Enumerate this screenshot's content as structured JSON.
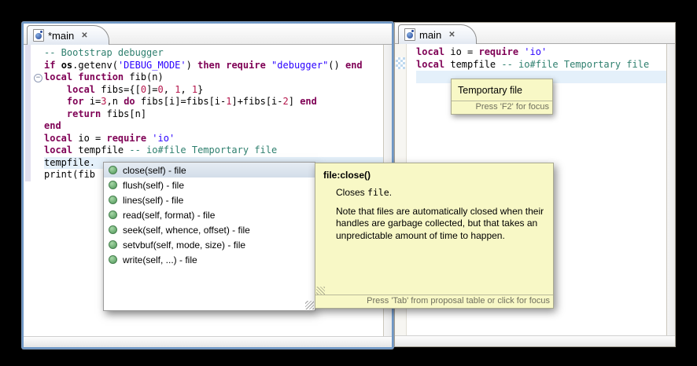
{
  "left_editor": {
    "tab": {
      "label": "*main",
      "icon": "lua-file-icon"
    },
    "lines": [
      [
        {
          "t": "-- Bootstrap debugger",
          "c": "c"
        }
      ],
      [
        {
          "t": "if",
          "c": "k"
        },
        {
          "t": " ",
          "c": "p"
        },
        {
          "t": "os",
          "c": "b"
        },
        {
          "t": ".getenv(",
          "c": "p"
        },
        {
          "t": "'DEBUG_MODE'",
          "c": "s"
        },
        {
          "t": ") ",
          "c": "p"
        },
        {
          "t": "then",
          "c": "k"
        },
        {
          "t": " ",
          "c": "p"
        },
        {
          "t": "require",
          "c": "k"
        },
        {
          "t": " ",
          "c": "p"
        },
        {
          "t": "\"debugger\"",
          "c": "s"
        },
        {
          "t": "() ",
          "c": "p"
        },
        {
          "t": "end",
          "c": "k"
        }
      ],
      [
        {
          "t": "local",
          "c": "k"
        },
        {
          "t": " ",
          "c": "p"
        },
        {
          "t": "function",
          "c": "k"
        },
        {
          "t": " fib(n)",
          "c": "p"
        }
      ],
      [
        {
          "t": "    ",
          "c": "p"
        },
        {
          "t": "local",
          "c": "k"
        },
        {
          "t": " fibs={[",
          "c": "p"
        },
        {
          "t": "0",
          "c": "n"
        },
        {
          "t": "]=",
          "c": "p"
        },
        {
          "t": "0",
          "c": "n"
        },
        {
          "t": ", ",
          "c": "p"
        },
        {
          "t": "1",
          "c": "n"
        },
        {
          "t": ", ",
          "c": "p"
        },
        {
          "t": "1",
          "c": "n"
        },
        {
          "t": "}",
          "c": "p"
        }
      ],
      [
        {
          "t": "    ",
          "c": "p"
        },
        {
          "t": "for",
          "c": "k"
        },
        {
          "t": " i=",
          "c": "p"
        },
        {
          "t": "3",
          "c": "n"
        },
        {
          "t": ",n ",
          "c": "p"
        },
        {
          "t": "do",
          "c": "k"
        },
        {
          "t": " fibs[i]=fibs[i-",
          "c": "p"
        },
        {
          "t": "1",
          "c": "n"
        },
        {
          "t": "]+fibs[i-",
          "c": "p"
        },
        {
          "t": "2",
          "c": "n"
        },
        {
          "t": "] ",
          "c": "p"
        },
        {
          "t": "end",
          "c": "k"
        }
      ],
      [
        {
          "t": "    ",
          "c": "p"
        },
        {
          "t": "return",
          "c": "k"
        },
        {
          "t": " fibs[n]",
          "c": "p"
        }
      ],
      [
        {
          "t": "end",
          "c": "k"
        }
      ],
      [
        {
          "t": "local",
          "c": "k"
        },
        {
          "t": " io = ",
          "c": "p"
        },
        {
          "t": "require",
          "c": "k"
        },
        {
          "t": " ",
          "c": "p"
        },
        {
          "t": "'io'",
          "c": "s"
        }
      ],
      [
        {
          "t": "local",
          "c": "k"
        },
        {
          "t": " tempfile ",
          "c": "p"
        },
        {
          "t": "-- io#file Temportary file",
          "c": "c"
        }
      ],
      [
        {
          "t": "tempfile.",
          "c": "p"
        }
      ],
      [
        {
          "t": "print(fib",
          "c": "p"
        }
      ]
    ]
  },
  "right_editor": {
    "tab": {
      "label": "main",
      "icon": "lua-file-icon"
    },
    "lines": [
      [
        {
          "t": "local",
          "c": "k"
        },
        {
          "t": " io = ",
          "c": "p"
        },
        {
          "t": "require",
          "c": "k"
        },
        {
          "t": " ",
          "c": "p"
        },
        {
          "t": "'io'",
          "c": "s"
        }
      ],
      [
        {
          "t": "local",
          "c": "k"
        },
        {
          "t": " tempfile ",
          "c": "p"
        },
        {
          "t": "-- io#file Temportary file",
          "c": "c"
        }
      ],
      []
    ]
  },
  "completion": {
    "items": [
      {
        "label": "close(self) - file",
        "selected": true
      },
      {
        "label": "flush(self) - file",
        "selected": false
      },
      {
        "label": "lines(self) - file",
        "selected": false
      },
      {
        "label": "read(self, format) - file",
        "selected": false
      },
      {
        "label": "seek(self, whence, offset) - file",
        "selected": false
      },
      {
        "label": "setvbuf(self, mode, size) - file",
        "selected": false
      },
      {
        "label": "write(self, ...) - file",
        "selected": false
      }
    ]
  },
  "doc_popup": {
    "title": "file:close()",
    "closes_prefix": "Closes ",
    "closes_code": "file",
    "closes_suffix": ".",
    "note": "Note that files are automatically closed when their handles are garbage collected, but that takes an unpredictable amount of time to happen.",
    "footer": "Press 'Tab' from proposal table or click for focus"
  },
  "tooltip": {
    "text": "Temportary file",
    "footer": "Press 'F2' for focus"
  },
  "icons": {
    "close_glyph": "✕",
    "fold_collapse_glyph": "−"
  },
  "colors": {
    "keyword": "#7F0055",
    "string": "#2A00FF",
    "comment": "#2E7F6E",
    "number": "#B5154B",
    "current_line_bg": "#E4F0FA",
    "info_popup_bg": "#F8F8C6",
    "active_pane_border": "#6E97C6",
    "completion_selection_bg": "#D3DDE9",
    "completion_icon_green": "#4E9658"
  }
}
